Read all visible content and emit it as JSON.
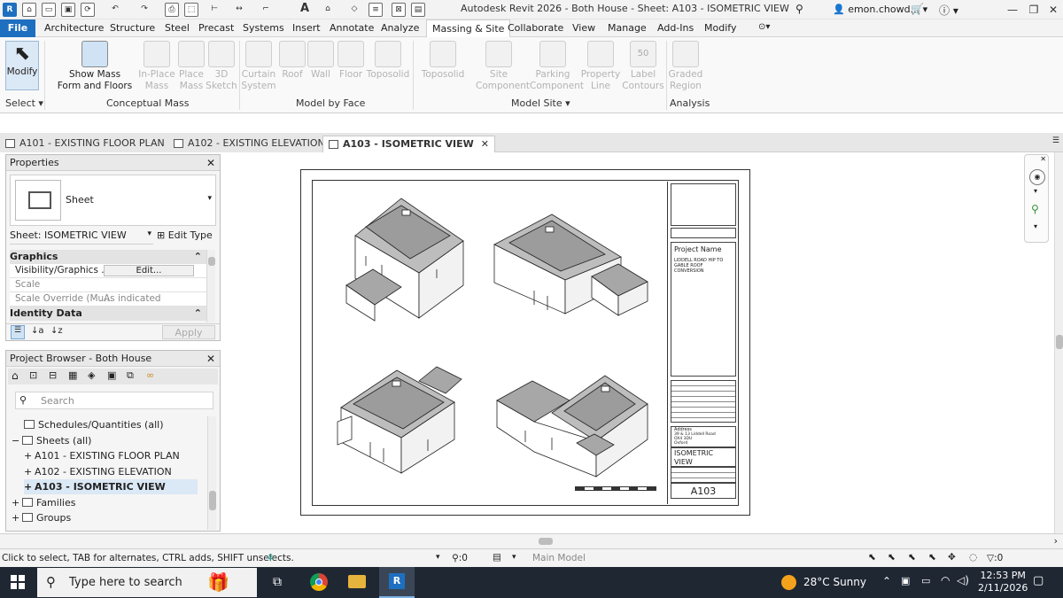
{
  "app": {
    "title": "Autodesk Revit 2026 - Both House - Sheet: A103 - ISOMETRIC VIEW",
    "user": "emon.chowd...",
    "icon_letter": "R"
  },
  "menu": {
    "file": "File",
    "tabs": [
      "Architecture",
      "Structure",
      "Steel",
      "Precast",
      "Systems",
      "Insert",
      "Annotate",
      "Analyze",
      "Massing & Site",
      "Collaborate",
      "View",
      "Manage",
      "Add-Ins",
      "Modify"
    ],
    "active": "Massing & Site"
  },
  "ribbon": {
    "modify": "Modify",
    "select": "Select",
    "show_mass": "Show Mass\nForm and Floors",
    "conceptual_mass": [
      "In-Place\nMass",
      "Place\nMass",
      "3D\nSketch"
    ],
    "conceptual_mass_label": "Conceptual Mass",
    "model_by_face": [
      "Curtain\nSystem",
      "Roof",
      "Wall",
      "Floor",
      "Toposolid"
    ],
    "model_by_face_label": "Model by Face",
    "model_site": [
      "Toposolid",
      "Site\nComponent",
      "Parking\nComponent",
      "Property\nLine",
      "Label\nContours"
    ],
    "model_site_label": "Model Site",
    "contour_value": "50",
    "analysis": [
      "Graded\nRegion"
    ],
    "analysis_label": "Analysis"
  },
  "doc_tabs": [
    {
      "label": "A101 - EXISTING FLOOR PLAN",
      "active": false
    },
    {
      "label": "A102 - EXISTING ELEVATION",
      "active": false
    },
    {
      "label": "A103 - ISOMETRIC VIEW",
      "active": true
    }
  ],
  "properties": {
    "title": "Properties",
    "type": "Sheet",
    "selector": "Sheet: ISOMETRIC VIEW",
    "edit_type": "Edit Type",
    "sections": {
      "graphics": "Graphics",
      "identity": "Identity Data"
    },
    "rows": [
      {
        "name": "Visibility/Graphics ...",
        "value": "Edit..."
      },
      {
        "name": "Scale",
        "value": ""
      },
      {
        "name": "Scale Override (Mu...",
        "value": "As indicated"
      }
    ],
    "apply": "Apply"
  },
  "browser": {
    "title": "Project Browser - Both House",
    "search_placeholder": "Search",
    "items": [
      {
        "label": "Schedules/Quantities (all)",
        "prefix": "",
        "indent": 1
      },
      {
        "label": "Sheets (all)",
        "prefix": "−",
        "indent": 0
      },
      {
        "label": "A101 - EXISTING FLOOR PLAN",
        "prefix": "+",
        "indent": 1
      },
      {
        "label": "A102 - EXISTING ELEVATION",
        "prefix": "+",
        "indent": 1
      },
      {
        "label": "A103 - ISOMETRIC VIEW",
        "prefix": "+",
        "indent": 1,
        "selected": true
      },
      {
        "label": "Families",
        "prefix": "+",
        "indent": 0
      },
      {
        "label": "Groups",
        "prefix": "+",
        "indent": 0
      }
    ]
  },
  "titleblock": {
    "project_name": "Project Name",
    "project_desc": "LIDDELL ROAD HIP TO GABLE ROOF CONVERSION",
    "address_label": "Address",
    "address": "39 & 13 Liddell Road\nOX4 3DU\nOxford",
    "view_name": "ISOMETRIC VIEW",
    "sheet_number": "A103"
  },
  "status": {
    "hint": "Click to select, TAB for alternates, CTRL adds, SHIFT unselects.",
    "sel_count": ":0",
    "model": "Main Model",
    "filter_count": ":0"
  },
  "taskbar": {
    "search": "Type here to search",
    "weather": "28°C  Sunny",
    "time": "12:53 PM",
    "date": "2/11/2026"
  }
}
